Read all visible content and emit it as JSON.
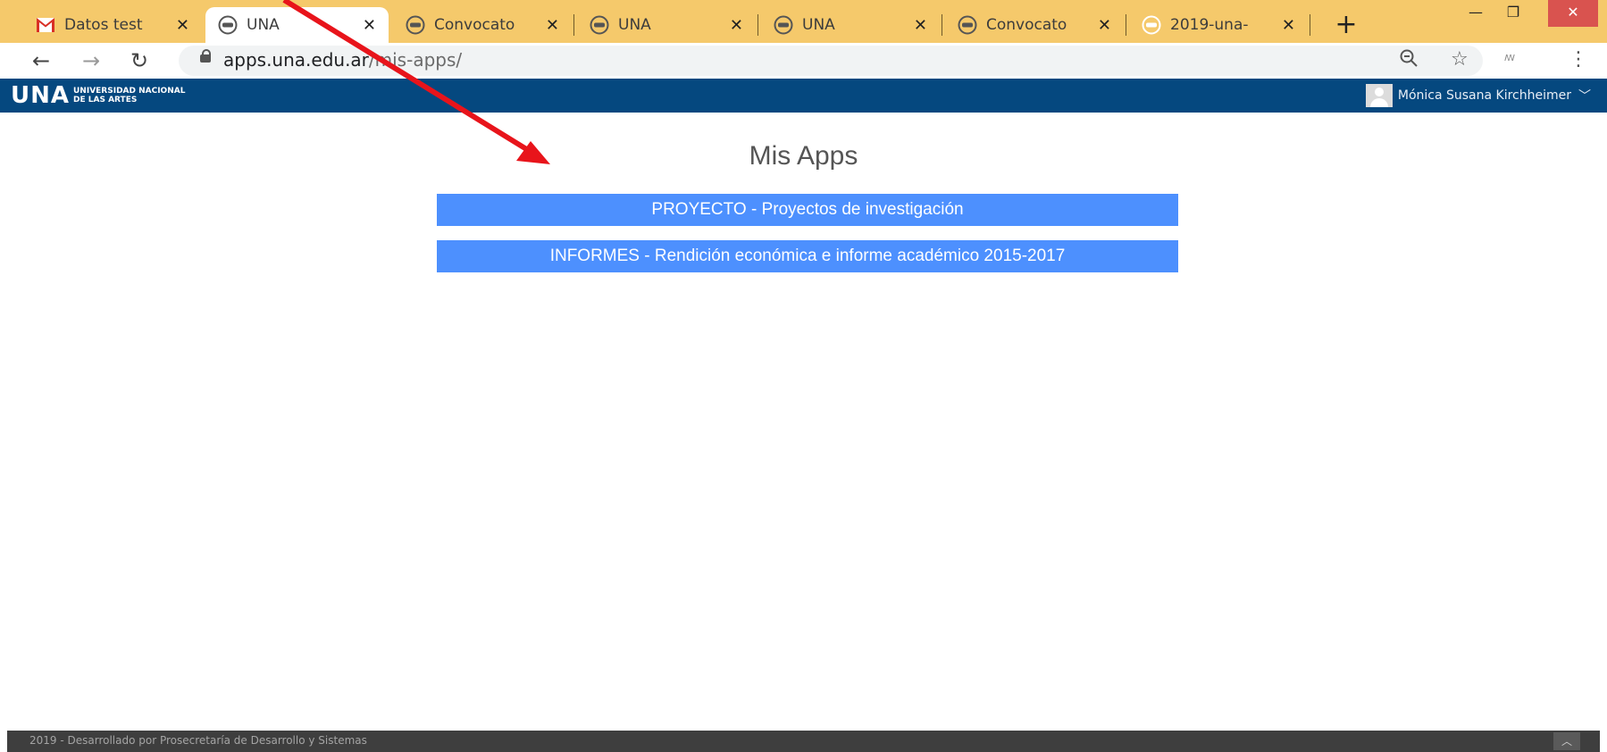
{
  "tabs": [
    {
      "title": "Datos test",
      "icon": "gmail-icon"
    },
    {
      "title": "UNA",
      "icon": "una-icon"
    },
    {
      "title": "Convocato",
      "icon": "una-icon"
    },
    {
      "title": "UNA",
      "icon": "una-icon"
    },
    {
      "title": "UNA",
      "icon": "una-icon"
    },
    {
      "title": "Convocato",
      "icon": "una-icon"
    },
    {
      "title": "2019-una-",
      "icon": "una-icon"
    }
  ],
  "active_tab": "UNA",
  "address": {
    "host": "apps.una.edu.ar",
    "path": "/mis-apps/"
  },
  "site": {
    "logo_big": "UNA",
    "logo_line1": "UNIVERSIDAD NACIONAL",
    "logo_line2": "DE LAS ARTES",
    "user_name": "Mónica Susana Kirchheimer"
  },
  "main": {
    "title": "Mis Apps",
    "apps": [
      {
        "label": "PROYECTO - Proyectos de investigación"
      },
      {
        "label": "INFORMES - Rendición económica e informe académico 2015-2017"
      }
    ]
  },
  "footer": {
    "text": "2019 - Desarrollado por Prosecretaría de Desarrollo y Sistemas"
  },
  "colors": {
    "tab_strip": "#f5c96b",
    "header": "#05487f",
    "button": "#4d90fe",
    "footer": "#3e3e3e",
    "annotation_arrow": "#e8141b"
  }
}
